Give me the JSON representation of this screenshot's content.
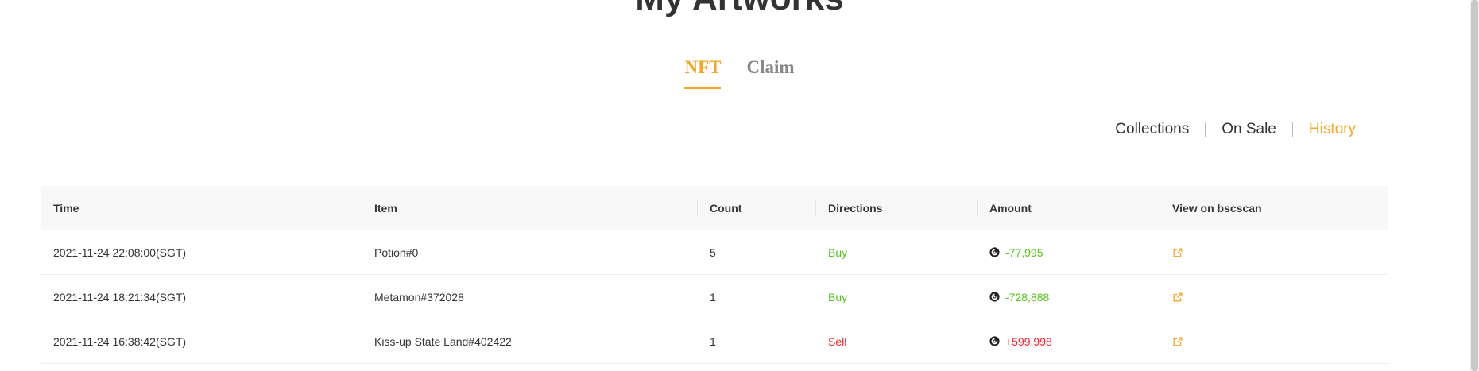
{
  "page": {
    "title": "My Artworks"
  },
  "tabs": [
    {
      "label": "NFT",
      "active": true
    },
    {
      "label": "Claim",
      "active": false
    }
  ],
  "subnav": [
    {
      "label": "Collections",
      "active": false
    },
    {
      "label": "On Sale",
      "active": false
    },
    {
      "label": "History",
      "active": true
    }
  ],
  "table": {
    "headers": [
      "Time",
      "Item",
      "Count",
      "Directions",
      "Amount",
      "View on bscscan"
    ],
    "rows": [
      {
        "time": "2021-11-24 22:08:00(SGT)",
        "item": "Potion#0",
        "count": "5",
        "direction": "Buy",
        "amount": "-77,995"
      },
      {
        "time": "2021-11-24 18:21:34(SGT)",
        "item": "Metamon#372028",
        "count": "1",
        "direction": "Buy",
        "amount": "-728,888"
      },
      {
        "time": "2021-11-24 16:38:42(SGT)",
        "item": "Kiss-up State Land#402422",
        "count": "1",
        "direction": "Sell",
        "amount": "+599,998"
      }
    ]
  },
  "icons": {
    "coin": "coin-icon",
    "link": "external-link-icon"
  },
  "colors": {
    "accent": "#f5a623",
    "buy": "#52c41a",
    "sell": "#f5222d"
  }
}
